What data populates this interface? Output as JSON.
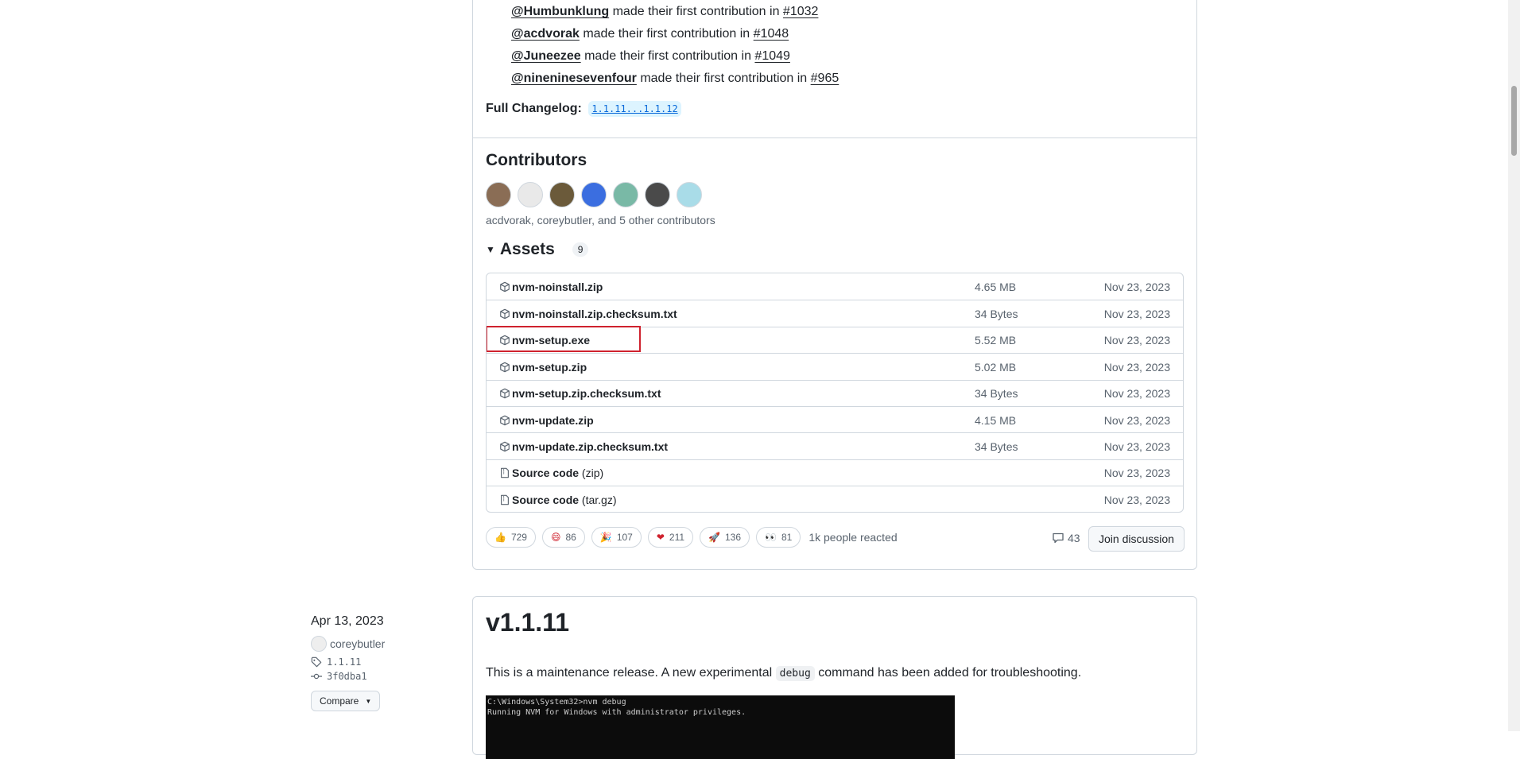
{
  "contributions": [
    {
      "user": "@Humbunklung",
      "text": "made their first contribution in",
      "pr": "#1032"
    },
    {
      "user": "@acdvorak",
      "text": "made their first contribution in",
      "pr": "#1048"
    },
    {
      "user": "@Juneezee",
      "text": "made their first contribution in",
      "pr": "#1049"
    },
    {
      "user": "@nineninesevenfour",
      "text": "made their first contribution in",
      "pr": "#965"
    }
  ],
  "changelog": {
    "label": "Full Changelog:",
    "link": "1.1.11...1.1.12"
  },
  "contributors": {
    "title": "Contributors",
    "summary": "acdvorak, coreybutler, and 5 other contributors",
    "avatar_colors": [
      "#8a6d55",
      "#e9e9e9",
      "#6b5a3a",
      "#3b6ee0",
      "#79b9a6",
      "#4a4a4a",
      "#a9dce8"
    ]
  },
  "assets": {
    "title": "Assets",
    "count": "9",
    "items": [
      {
        "name": "nvm-noinstall.zip",
        "size": "4.65 MB",
        "date": "Nov 23, 2023",
        "icon": "package-icon"
      },
      {
        "name": "nvm-noinstall.zip.checksum.txt",
        "size": "34 Bytes",
        "date": "Nov 23, 2023",
        "icon": "package-icon"
      },
      {
        "name": "nvm-setup.exe",
        "size": "5.52 MB",
        "date": "Nov 23, 2023",
        "icon": "package-icon"
      },
      {
        "name": "nvm-setup.zip",
        "size": "5.02 MB",
        "date": "Nov 23, 2023",
        "icon": "package-icon"
      },
      {
        "name": "nvm-setup.zip.checksum.txt",
        "size": "34 Bytes",
        "date": "Nov 23, 2023",
        "icon": "package-icon"
      },
      {
        "name": "nvm-update.zip",
        "size": "4.15 MB",
        "date": "Nov 23, 2023",
        "icon": "package-icon"
      },
      {
        "name": "nvm-update.zip.checksum.txt",
        "size": "34 Bytes",
        "date": "Nov 23, 2023",
        "icon": "package-icon"
      },
      {
        "name": "Source code",
        "suffix": "(zip)",
        "size": "",
        "date": "Nov 23, 2023",
        "icon": "file-zip-icon"
      },
      {
        "name": "Source code",
        "suffix": "(tar.gz)",
        "size": "",
        "date": "Nov 23, 2023",
        "icon": "file-zip-icon"
      }
    ]
  },
  "reactions": [
    {
      "emoji": "👍",
      "count": "729",
      "icon": "thumbs-up-icon"
    },
    {
      "emoji": "😄",
      "count": "86",
      "icon": "smile-icon"
    },
    {
      "emoji": "🎉",
      "count": "107",
      "icon": "tada-icon"
    },
    {
      "emoji": "❤",
      "count": "211",
      "icon": "heart-icon"
    },
    {
      "emoji": "🚀",
      "count": "136",
      "icon": "rocket-icon"
    },
    {
      "emoji": "👀",
      "count": "81",
      "icon": "eyes-icon"
    }
  ],
  "reacted_text": "1k people reacted",
  "comments_count": "43",
  "join_label": "Join discussion",
  "release_meta": {
    "date": "Apr 13, 2023",
    "author": "coreybutler",
    "tag": "1.1.11",
    "commit": "3f0dba1",
    "compare_label": "Compare"
  },
  "release": {
    "title": "v1.1.11",
    "desc_before": "This is a maintenance release. A new experimental",
    "desc_code": "debug",
    "desc_after": "command has been added for troubleshooting.",
    "terminal_lines": [
      "C:\\Windows\\System32>nvm debug",
      "Running NVM for Windows with administrator privileges."
    ]
  }
}
